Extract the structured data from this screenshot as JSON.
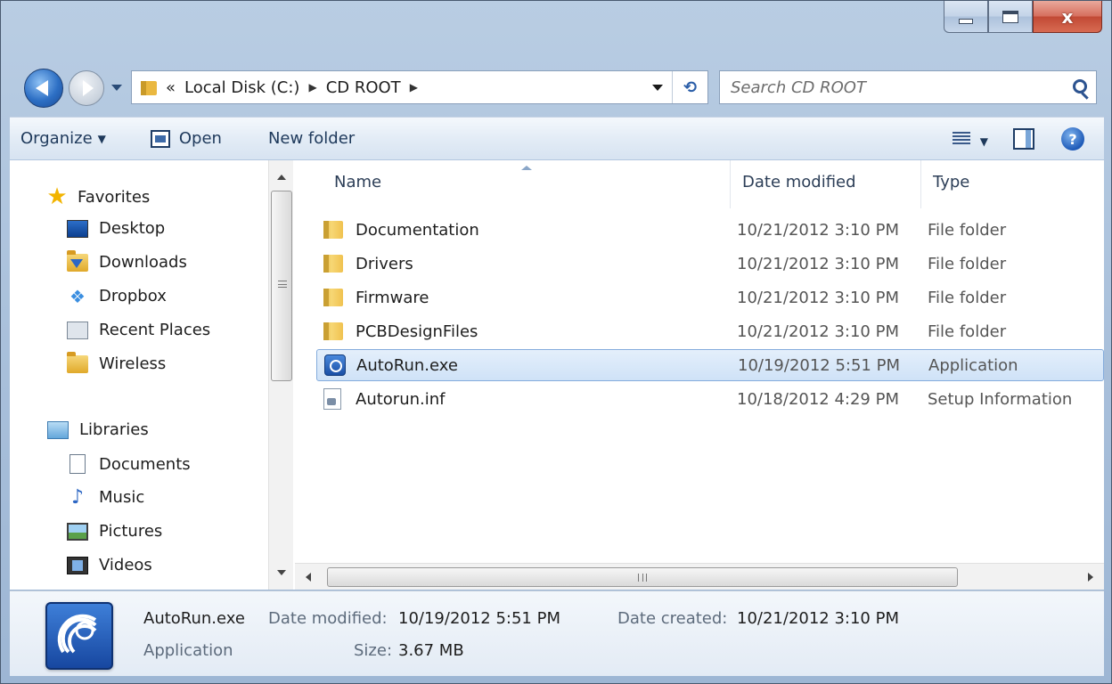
{
  "window": {
    "minimize_icon": "minimize-icon",
    "maximize_icon": "maximize-icon",
    "close_label": "x"
  },
  "address_bar": {
    "overflow": "«",
    "crumbs": [
      "Local Disk (C:)",
      "CD ROOT"
    ],
    "refresh_label": "⟲"
  },
  "search": {
    "placeholder": "Search CD ROOT"
  },
  "toolbar": {
    "organize_label": "Organize",
    "open_label": "Open",
    "new_folder_label": "New folder",
    "help_label": "?"
  },
  "nav_pane": {
    "favorites_label": "Favorites",
    "favorites": [
      {
        "label": "Desktop",
        "icon": "desktop-icon"
      },
      {
        "label": "Downloads",
        "icon": "downloads-folder-icon"
      },
      {
        "label": "Dropbox",
        "icon": "dropbox-icon"
      },
      {
        "label": "Recent Places",
        "icon": "recent-places-icon"
      },
      {
        "label": "Wireless",
        "icon": "folder-icon"
      }
    ],
    "libraries_label": "Libraries",
    "libraries": [
      {
        "label": "Documents",
        "icon": "documents-icon"
      },
      {
        "label": "Music",
        "icon": "music-icon"
      },
      {
        "label": "Pictures",
        "icon": "pictures-icon"
      },
      {
        "label": "Videos",
        "icon": "videos-icon"
      }
    ]
  },
  "file_list": {
    "columns": [
      "Name",
      "Date modified",
      "Type"
    ],
    "rows": [
      {
        "name": "Documentation",
        "date": "10/21/2012 3:10 PM",
        "type": "File folder",
        "icon": "folder-icon"
      },
      {
        "name": "Drivers",
        "date": "10/21/2012 3:10 PM",
        "type": "File folder",
        "icon": "folder-icon"
      },
      {
        "name": "Firmware",
        "date": "10/21/2012 3:10 PM",
        "type": "File folder",
        "icon": "folder-icon"
      },
      {
        "name": "PCBDesignFiles",
        "date": "10/21/2012 3:10 PM",
        "type": "File folder",
        "icon": "folder-icon"
      },
      {
        "name": "AutoRun.exe",
        "date": "10/19/2012 5:51 PM",
        "type": "Application",
        "icon": "application-icon",
        "selected": true
      },
      {
        "name": "Autorun.inf",
        "date": "10/18/2012 4:29 PM",
        "type": "Setup Information",
        "icon": "setup-info-icon"
      }
    ],
    "hscroll_grip": "III"
  },
  "details": {
    "file_name": "AutoRun.exe",
    "file_type": "Application",
    "date_modified_label": "Date modified:",
    "date_modified": "10/19/2012 5:51 PM",
    "size_label": "Size:",
    "size": "3.67 MB",
    "date_created_label": "Date created:",
    "date_created": "10/21/2012 3:10 PM"
  },
  "colors": {
    "selection_bg": "#cfe2f7",
    "selection_border": "#84acdd",
    "window_chrome": "#a9c0db"
  }
}
